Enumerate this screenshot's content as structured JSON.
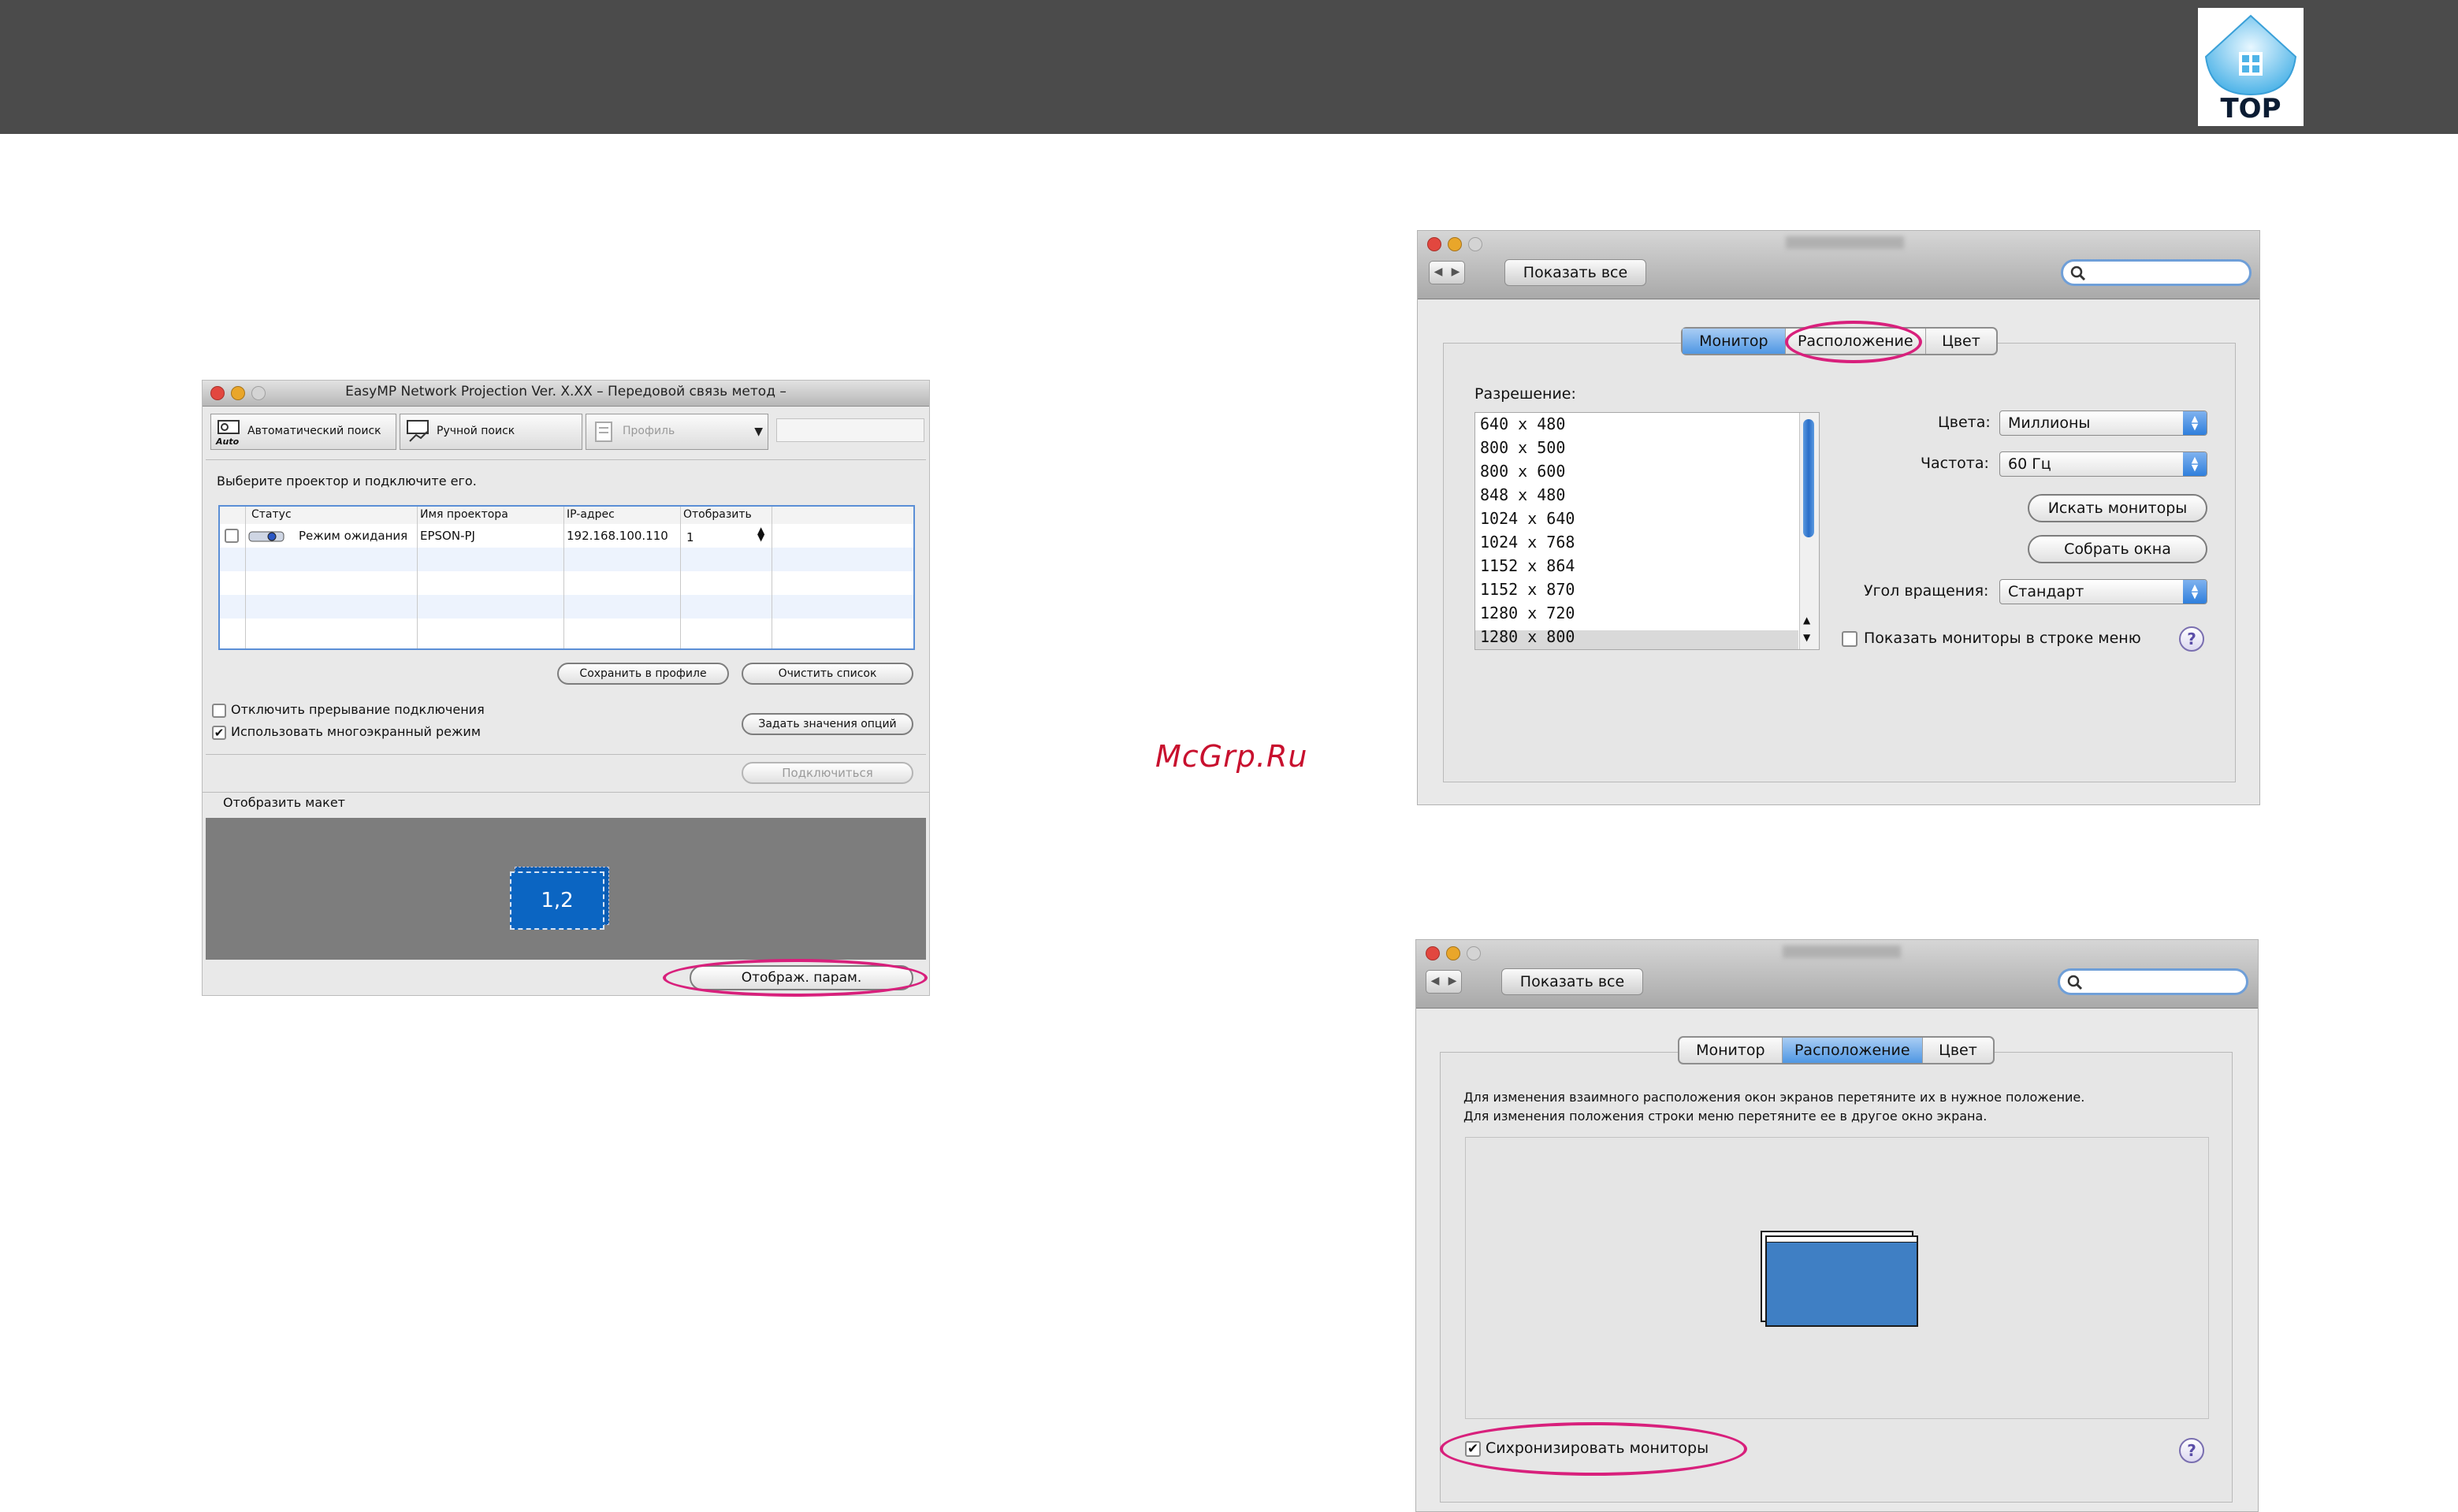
{
  "top_logo": {
    "text": "TOP",
    "icon": "house-icon"
  },
  "watermark": "McGrp.Ru",
  "easymp": {
    "title": "EasyMP Network Projection Ver. X.XX – Передовой связь метод –",
    "toolbar": {
      "auto_search": "Автоматический поиск",
      "auto_badge": "Auto",
      "manual_search": "Ручной поиск",
      "profile": "Профиль"
    },
    "instruction": "Выберите проектор и подключите его.",
    "table": {
      "headers": [
        "Статус",
        "Имя проектора",
        "IP-адрес",
        "Отобразить"
      ],
      "rows": [
        {
          "status": "Режим ожидания",
          "name": "EPSON-PJ",
          "ip": "192.168.100.110",
          "display": "1"
        }
      ]
    },
    "buttons": {
      "save_profile": "Сохранить в профиле",
      "clear_list": "Очистить список",
      "set_options": "Задать значения опций",
      "connect": "Подключиться",
      "display_params": "Отображ. парам."
    },
    "checkboxes": {
      "disable_interrupt": {
        "label": "Отключить прерывание подключения",
        "checked": false
      },
      "multi_screen": {
        "label": "Использовать многоэкранный режим",
        "checked": true
      }
    },
    "layout": {
      "label": "Отобразить макет",
      "screen_label": "1,2"
    }
  },
  "prefs_monitor": {
    "show_all": "Показать все",
    "tabs": [
      "Монитор",
      "Расположение",
      "Цвет"
    ],
    "active_tab": "Монитор",
    "resolution_label": "Разрешение:",
    "resolutions": [
      "640 x 480",
      "800 x 500",
      "800 x 600",
      "848 x 480",
      "1024 x 640",
      "1024 x 768",
      "1152 x 864",
      "1152 x 870",
      "1280 x 720",
      "1280 x 800"
    ],
    "selected_resolution": "1280 x 800",
    "colors_label": "Цвета:",
    "colors_value": "Миллионы",
    "refresh_label": "Частота:",
    "refresh_value": "60 Гц",
    "detect_button": "Искать мониторы",
    "gather_button": "Собрать окна",
    "rotation_label": "Угол вращения:",
    "rotation_value": "Стандарт",
    "menu_bar_checkbox": "Показать мониторы в строке меню",
    "help": "?"
  },
  "prefs_arrangement": {
    "show_all": "Показать все",
    "tabs": [
      "Монитор",
      "Расположение",
      "Цвет"
    ],
    "active_tab": "Расположение",
    "instruction_1": "Для изменения взаимного расположения окон экранов перетяните их в нужное положение.",
    "instruction_2": "Для изменения положения строки меню перетяните ее в другое окно экрана.",
    "mirror_checkbox": "Сихронизировать мониторы",
    "mirror_checked": true,
    "help": "?"
  },
  "colors": {
    "header": "#4b4b4b",
    "highlight": "#d8207c",
    "watermark": "#c8102e",
    "selection_blue": "#4f97e3",
    "screen_blue": "#3f7fc4"
  }
}
